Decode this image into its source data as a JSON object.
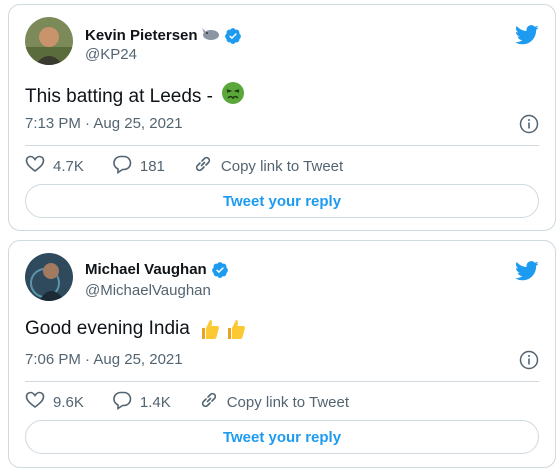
{
  "colors": {
    "accent": "#1d9bf0",
    "secondary_text": "#536471",
    "border": "#cfd9de",
    "text": "#0f1419"
  },
  "tweets": [
    {
      "author_name": "Kevin Pietersen",
      "name_emoji_icon": "rhinoceros-icon",
      "handle": "@KP24",
      "text": "This batting at Leeds -",
      "text_emoji_icon": "nauseated-face-icon",
      "timestamp": "7:13 PM · Aug 25, 2021",
      "likes": "4.7K",
      "replies": "181",
      "copy_link_label": "Copy link to Tweet",
      "reply_button_label": "Tweet your reply"
    },
    {
      "author_name": "Michael Vaughan",
      "handle": "@MichaelVaughan",
      "text": "Good evening India",
      "text_emoji_icon": "thumbs-up-icon",
      "timestamp": "7:06 PM · Aug 25, 2021",
      "likes": "9.6K",
      "replies": "1.4K",
      "copy_link_label": "Copy link to Tweet",
      "reply_button_label": "Tweet your reply"
    }
  ]
}
